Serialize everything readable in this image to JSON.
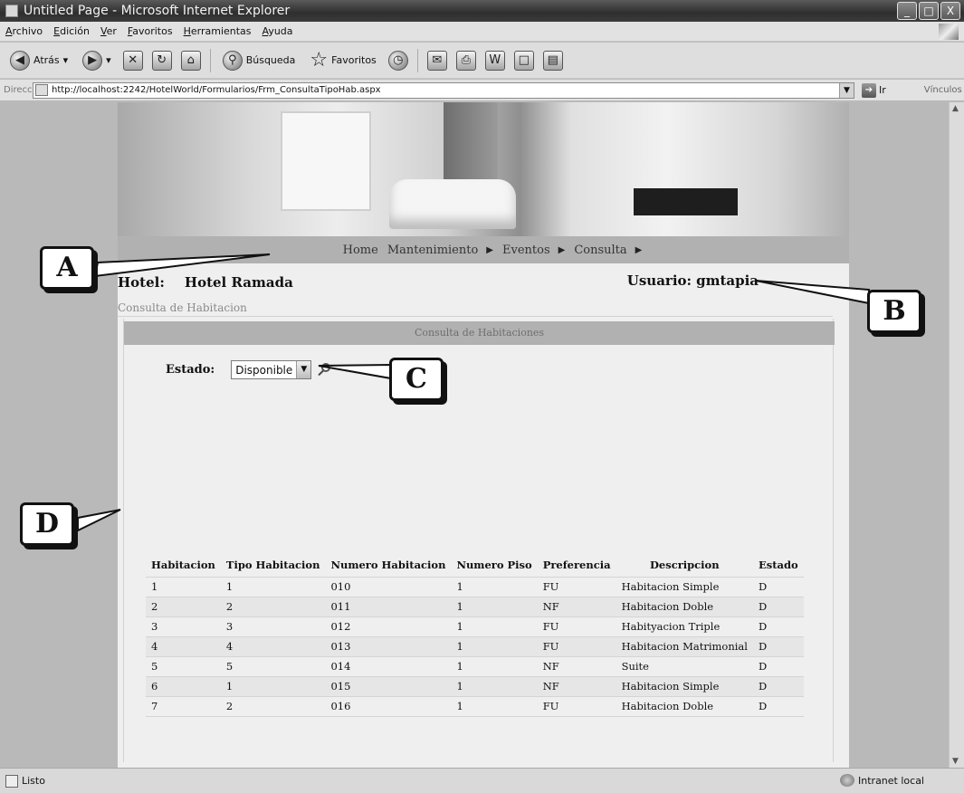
{
  "window": {
    "title": "Untitled Page - Microsoft Internet Explorer",
    "controls": [
      "_",
      "□",
      "X"
    ]
  },
  "menu": [
    "Archivo",
    "Edición",
    "Ver",
    "Favoritos",
    "Herramientas",
    "Ayuda"
  ],
  "toolbar": {
    "back_label": "Atrás",
    "search_label": "Búsqueda",
    "favorites_label": "Favoritos"
  },
  "address": {
    "label": "Dirección",
    "url": "http://localhost:2242/HotelWorld/Formularios/Frm_ConsultaTipoHab.aspx",
    "go_label": "Ir",
    "links_label": "Vínculos"
  },
  "nav": {
    "home": "Home",
    "items": [
      "Mantenimiento",
      "Eventos",
      "Consulta"
    ]
  },
  "hotel": {
    "label": "Hotel:",
    "name": "Hotel Ramada"
  },
  "user": {
    "label": "Usuario:",
    "name": "gmtapia"
  },
  "section_title": "Consulta de Habitacion",
  "panel_title": "Consulta de Habitaciones",
  "filter": {
    "label": "Estado:",
    "selected": "Disponible"
  },
  "table": {
    "headers": [
      "Habitacion",
      "Tipo Habitacion",
      "Numero Habitacion",
      "Numero Piso",
      "Preferencia",
      "Descripcion",
      "Estado"
    ],
    "rows": [
      [
        "1",
        "1",
        "010",
        "1",
        "FU",
        "Habitacion Simple",
        "D"
      ],
      [
        "2",
        "2",
        "011",
        "1",
        "NF",
        "Habitacion Doble",
        "D"
      ],
      [
        "3",
        "3",
        "012",
        "1",
        "FU",
        "Habityacion Triple",
        "D"
      ],
      [
        "4",
        "4",
        "013",
        "1",
        "FU",
        "Habitacion Matrimonial",
        "D"
      ],
      [
        "5",
        "5",
        "014",
        "1",
        "NF",
        "Suite",
        "D"
      ],
      [
        "6",
        "1",
        "015",
        "1",
        "NF",
        "Habitacion Simple",
        "D"
      ],
      [
        "7",
        "2",
        "016",
        "1",
        "FU",
        "Habitacion Doble",
        "D"
      ]
    ]
  },
  "callouts": [
    "A",
    "B",
    "C",
    "D"
  ],
  "status": {
    "left": "Listo",
    "zone": "Intranet local"
  }
}
